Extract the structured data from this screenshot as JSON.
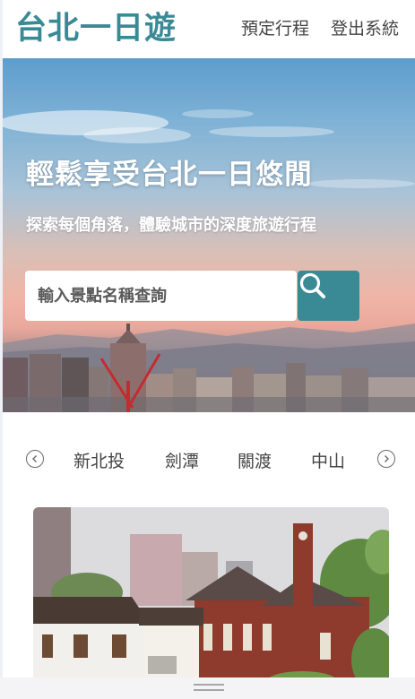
{
  "header": {
    "logo": "台北一日遊",
    "nav": [
      "預定行程",
      "登出系統"
    ]
  },
  "hero": {
    "title": "輕鬆享受台北一日悠閒",
    "subtitle": "探索每個角落，體驗城市的深度旅遊行程",
    "search_placeholder": "輸入景點名稱查詢"
  },
  "districts": [
    "新北投",
    "劍潭",
    "關渡",
    "中山"
  ],
  "colors": {
    "brand": "#3a8a96",
    "nav_text": "#444444"
  },
  "icons": {
    "search": "search-icon",
    "prev": "chevron-left-icon",
    "next": "chevron-right-icon"
  }
}
